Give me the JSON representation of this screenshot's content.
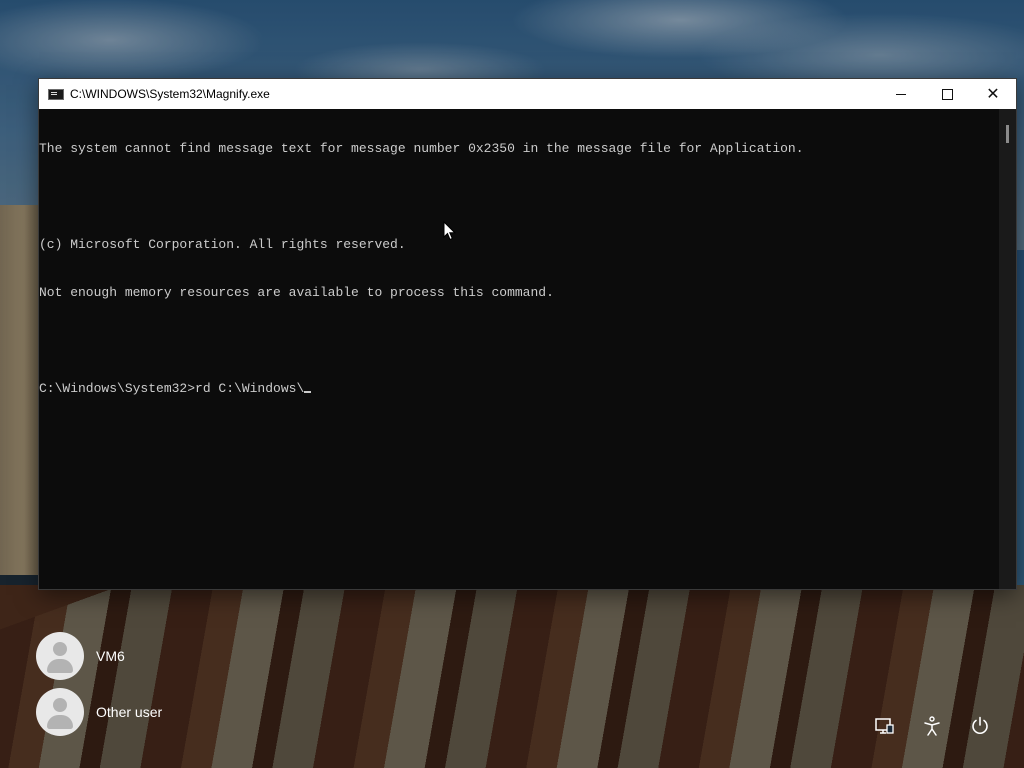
{
  "window": {
    "title": "C:\\WINDOWS\\System32\\Magnify.exe",
    "icon": "console-icon",
    "controls": {
      "minimize": "minimize-icon",
      "maximize": "maximize-icon",
      "close": "close-icon"
    }
  },
  "console": {
    "lines": [
      "The system cannot find message text for message number 0x2350 in the message file for Application.",
      "",
      "(c) Microsoft Corporation. All rights reserved.",
      "Not enough memory resources are available to process this command.",
      "",
      "C:\\Windows\\System32>rd C:\\Windows\\"
    ],
    "text_color": "#cccccc",
    "background_color": "#0c0c0c"
  },
  "users": [
    {
      "name": "VM6"
    },
    {
      "name": "Other user"
    }
  ],
  "system_buttons": [
    "network-icon",
    "accessibility-icon",
    "power-icon"
  ]
}
